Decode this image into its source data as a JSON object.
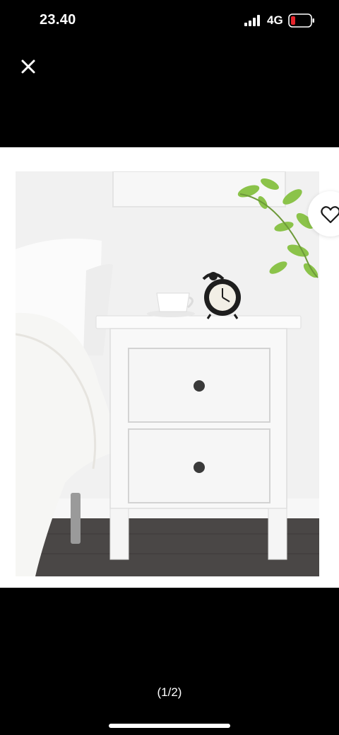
{
  "status_bar": {
    "time": "23.40",
    "network": "4G",
    "signal_icon": "cellular-signal-icon",
    "battery_icon": "battery-low-icon",
    "battery_accent": "#e5242b"
  },
  "viewer": {
    "close_icon": "close-icon",
    "favorite_icon": "heart-outline-icon",
    "page_counter": "(1/2)",
    "current_image": 1,
    "total_images": 2
  },
  "colors": {
    "background": "#000000",
    "image_backdrop": "#ffffff"
  }
}
